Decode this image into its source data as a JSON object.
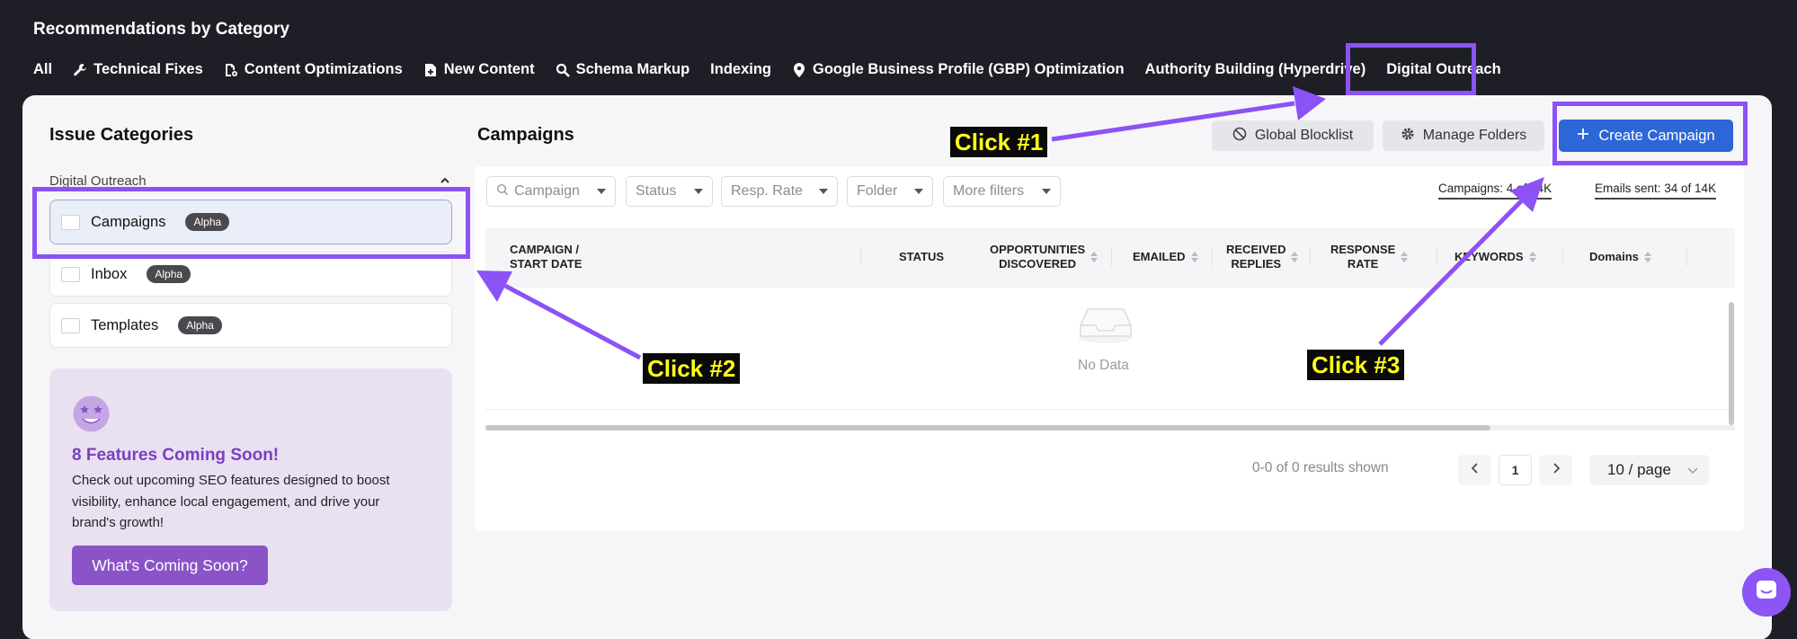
{
  "header": {
    "title": "Recommendations by Category",
    "tabs": [
      {
        "label": "All",
        "icon": ""
      },
      {
        "label": "Technical Fixes",
        "icon": "wrench-icon"
      },
      {
        "label": "Content Optimizations",
        "icon": "document-gear-icon"
      },
      {
        "label": "New Content",
        "icon": "document-plus-icon"
      },
      {
        "label": "Schema Markup",
        "icon": "magnifier-icon"
      },
      {
        "label": "Indexing",
        "icon": ""
      },
      {
        "label": "Google Business Profile (GBP) Optimization",
        "icon": "location-pin-icon"
      },
      {
        "label": "Authority Building (Hyperdrive)",
        "icon": ""
      },
      {
        "label": "Digital Outreach",
        "icon": ""
      }
    ],
    "active_tab": "Digital Outreach"
  },
  "sidebar": {
    "title": "Issue Categories",
    "group_label": "Digital Outreach",
    "items": [
      {
        "label": "Campaigns",
        "badge": "Alpha",
        "selected": true
      },
      {
        "label": "Inbox",
        "badge": "Alpha",
        "selected": false
      },
      {
        "label": "Templates",
        "badge": "Alpha",
        "selected": false
      }
    ],
    "promo": {
      "title": "8 Features Coming Soon!",
      "text": "Check out upcoming SEO features designed to boost visibility, enhance local engagement, and drive your brand's growth!",
      "button": "What's Coming Soon?"
    }
  },
  "main": {
    "title": "Campaigns",
    "buttons": {
      "blocklist": "Global Blocklist",
      "folders": "Manage Folders",
      "create": "Create Campaign"
    },
    "filters": {
      "campaign_placeholder": "Campaign",
      "status": "Status",
      "resp_rate": "Resp. Rate",
      "folder": "Folder",
      "more": "More filters"
    },
    "stats": {
      "campaigns": "Campaigns: 4 of 14K",
      "emails": "Emails sent: 34 of 14K"
    },
    "table": {
      "columns": [
        {
          "line1": "CAMPAIGN /",
          "line2": "START DATE"
        },
        {
          "line1": "STATUS",
          "line2": ""
        },
        {
          "line1": "OPPORTUNITIES",
          "line2": "DISCOVERED"
        },
        {
          "line1": "EMAILED",
          "line2": ""
        },
        {
          "line1": "RECEIVED",
          "line2": "REPLIES"
        },
        {
          "line1": "RESPONSE",
          "line2": "RATE"
        },
        {
          "line1": "KEYWORDS",
          "line2": ""
        },
        {
          "line1": "Domains",
          "line2": ""
        }
      ],
      "empty_text": "No Data"
    },
    "pagination": {
      "results": "0-0 of 0 results shown",
      "page": "1",
      "per_page": "10 / page"
    }
  },
  "annotations": {
    "click1": "Click #1",
    "click2": "Click #2",
    "click3": "Click #3"
  },
  "colors": {
    "accent_primary": "#2c66d8",
    "annotation_purple": "#8b52f5",
    "promo_purple": "#8a54c8",
    "callout_text": "#ffff1a"
  }
}
